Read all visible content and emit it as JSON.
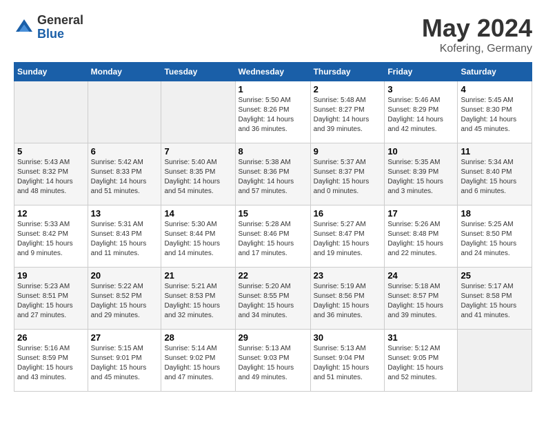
{
  "logo": {
    "general": "General",
    "blue": "Blue"
  },
  "title": "May 2024",
  "location": "Kofering, Germany",
  "days_header": [
    "Sunday",
    "Monday",
    "Tuesday",
    "Wednesday",
    "Thursday",
    "Friday",
    "Saturday"
  ],
  "weeks": [
    [
      {
        "num": "",
        "info": ""
      },
      {
        "num": "",
        "info": ""
      },
      {
        "num": "",
        "info": ""
      },
      {
        "num": "1",
        "info": "Sunrise: 5:50 AM\nSunset: 8:26 PM\nDaylight: 14 hours\nand 36 minutes."
      },
      {
        "num": "2",
        "info": "Sunrise: 5:48 AM\nSunset: 8:27 PM\nDaylight: 14 hours\nand 39 minutes."
      },
      {
        "num": "3",
        "info": "Sunrise: 5:46 AM\nSunset: 8:29 PM\nDaylight: 14 hours\nand 42 minutes."
      },
      {
        "num": "4",
        "info": "Sunrise: 5:45 AM\nSunset: 8:30 PM\nDaylight: 14 hours\nand 45 minutes."
      }
    ],
    [
      {
        "num": "5",
        "info": "Sunrise: 5:43 AM\nSunset: 8:32 PM\nDaylight: 14 hours\nand 48 minutes."
      },
      {
        "num": "6",
        "info": "Sunrise: 5:42 AM\nSunset: 8:33 PM\nDaylight: 14 hours\nand 51 minutes."
      },
      {
        "num": "7",
        "info": "Sunrise: 5:40 AM\nSunset: 8:35 PM\nDaylight: 14 hours\nand 54 minutes."
      },
      {
        "num": "8",
        "info": "Sunrise: 5:38 AM\nSunset: 8:36 PM\nDaylight: 14 hours\nand 57 minutes."
      },
      {
        "num": "9",
        "info": "Sunrise: 5:37 AM\nSunset: 8:37 PM\nDaylight: 15 hours\nand 0 minutes."
      },
      {
        "num": "10",
        "info": "Sunrise: 5:35 AM\nSunset: 8:39 PM\nDaylight: 15 hours\nand 3 minutes."
      },
      {
        "num": "11",
        "info": "Sunrise: 5:34 AM\nSunset: 8:40 PM\nDaylight: 15 hours\nand 6 minutes."
      }
    ],
    [
      {
        "num": "12",
        "info": "Sunrise: 5:33 AM\nSunset: 8:42 PM\nDaylight: 15 hours\nand 9 minutes."
      },
      {
        "num": "13",
        "info": "Sunrise: 5:31 AM\nSunset: 8:43 PM\nDaylight: 15 hours\nand 11 minutes."
      },
      {
        "num": "14",
        "info": "Sunrise: 5:30 AM\nSunset: 8:44 PM\nDaylight: 15 hours\nand 14 minutes."
      },
      {
        "num": "15",
        "info": "Sunrise: 5:28 AM\nSunset: 8:46 PM\nDaylight: 15 hours\nand 17 minutes."
      },
      {
        "num": "16",
        "info": "Sunrise: 5:27 AM\nSunset: 8:47 PM\nDaylight: 15 hours\nand 19 minutes."
      },
      {
        "num": "17",
        "info": "Sunrise: 5:26 AM\nSunset: 8:48 PM\nDaylight: 15 hours\nand 22 minutes."
      },
      {
        "num": "18",
        "info": "Sunrise: 5:25 AM\nSunset: 8:50 PM\nDaylight: 15 hours\nand 24 minutes."
      }
    ],
    [
      {
        "num": "19",
        "info": "Sunrise: 5:23 AM\nSunset: 8:51 PM\nDaylight: 15 hours\nand 27 minutes."
      },
      {
        "num": "20",
        "info": "Sunrise: 5:22 AM\nSunset: 8:52 PM\nDaylight: 15 hours\nand 29 minutes."
      },
      {
        "num": "21",
        "info": "Sunrise: 5:21 AM\nSunset: 8:53 PM\nDaylight: 15 hours\nand 32 minutes."
      },
      {
        "num": "22",
        "info": "Sunrise: 5:20 AM\nSunset: 8:55 PM\nDaylight: 15 hours\nand 34 minutes."
      },
      {
        "num": "23",
        "info": "Sunrise: 5:19 AM\nSunset: 8:56 PM\nDaylight: 15 hours\nand 36 minutes."
      },
      {
        "num": "24",
        "info": "Sunrise: 5:18 AM\nSunset: 8:57 PM\nDaylight: 15 hours\nand 39 minutes."
      },
      {
        "num": "25",
        "info": "Sunrise: 5:17 AM\nSunset: 8:58 PM\nDaylight: 15 hours\nand 41 minutes."
      }
    ],
    [
      {
        "num": "26",
        "info": "Sunrise: 5:16 AM\nSunset: 8:59 PM\nDaylight: 15 hours\nand 43 minutes."
      },
      {
        "num": "27",
        "info": "Sunrise: 5:15 AM\nSunset: 9:01 PM\nDaylight: 15 hours\nand 45 minutes."
      },
      {
        "num": "28",
        "info": "Sunrise: 5:14 AM\nSunset: 9:02 PM\nDaylight: 15 hours\nand 47 minutes."
      },
      {
        "num": "29",
        "info": "Sunrise: 5:13 AM\nSunset: 9:03 PM\nDaylight: 15 hours\nand 49 minutes."
      },
      {
        "num": "30",
        "info": "Sunrise: 5:13 AM\nSunset: 9:04 PM\nDaylight: 15 hours\nand 51 minutes."
      },
      {
        "num": "31",
        "info": "Sunrise: 5:12 AM\nSunset: 9:05 PM\nDaylight: 15 hours\nand 52 minutes."
      },
      {
        "num": "",
        "info": ""
      }
    ]
  ]
}
